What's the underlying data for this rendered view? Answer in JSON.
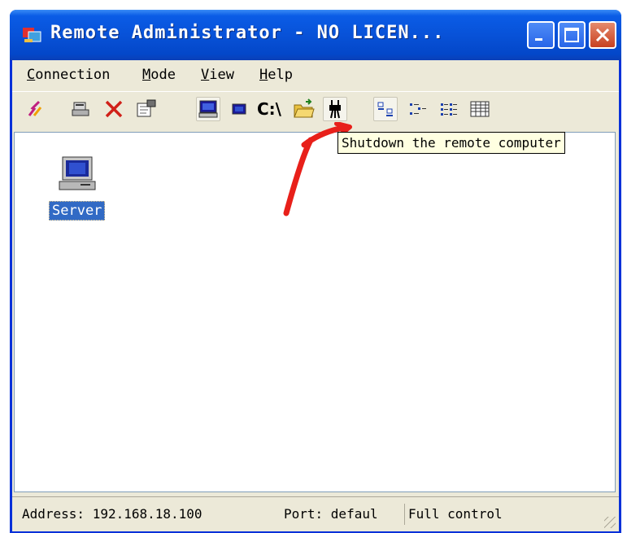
{
  "window": {
    "title": "Remote Administrator - NO LICEN...",
    "colors": {
      "titlebar": "#0852d8",
      "close": "#c8401f",
      "selection": "#316ac5",
      "annotation": "#e8201a"
    }
  },
  "menu": [
    {
      "hotkey": "C",
      "rest": "onnection"
    },
    {
      "hotkey": "M",
      "rest": "ode"
    },
    {
      "hotkey": "V",
      "rest": "iew"
    },
    {
      "hotkey": "H",
      "rest": "elp"
    }
  ],
  "toolbar": {
    "drive_label": "C:\\",
    "icons": [
      "connect-icon",
      "scanner-icon",
      "delete-icon",
      "properties-icon",
      "full-control-icon",
      "view-only-icon",
      "telnet-icon",
      "file-transfer-icon",
      "shutdown-icon",
      "large-icons-icon",
      "small-icons-icon",
      "list-icon",
      "details-icon"
    ]
  },
  "content": {
    "items": [
      {
        "label": "Server",
        "icon": "computer-icon"
      }
    ]
  },
  "tooltip": "Shutdown the remote computer",
  "status": {
    "address": "Address: 192.168.18.100",
    "port": "Port: defaul",
    "mode": "Full control"
  }
}
